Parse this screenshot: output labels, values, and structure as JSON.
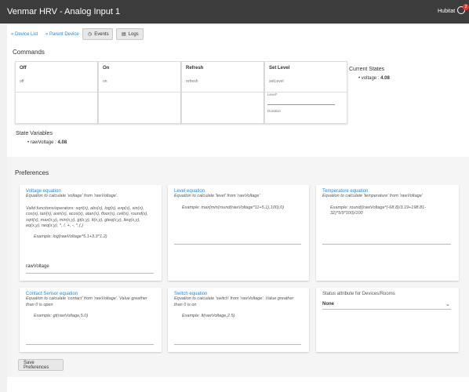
{
  "header": {
    "title": "Venmar HRV - Analog Input 1",
    "hub_name": "Hubitat",
    "notification_count": "2"
  },
  "nav": {
    "device_list": "« Device List",
    "parent_device": "« Parent Device",
    "events": "Events",
    "logs": "Logs"
  },
  "commands": {
    "heading": "Commands",
    "items": [
      {
        "name": "Off",
        "sub": "off"
      },
      {
        "name": "On",
        "sub": "on"
      },
      {
        "name": "Refresh",
        "sub": "refresh"
      },
      {
        "name": "Set Level",
        "sub": "setLevel",
        "field1": "Level*",
        "field2": "Duration"
      }
    ]
  },
  "current_states": {
    "heading": "Current States",
    "items": [
      {
        "name": "voltage",
        "value": "4.08"
      }
    ]
  },
  "state_variables": {
    "heading": "State Variables",
    "items": [
      {
        "name": "rawVoltage",
        "value": "4.08"
      }
    ]
  },
  "preferences": {
    "heading": "Preferences",
    "voltage": {
      "title": "Voltage equation",
      "desc": "Equation to calculate 'voltage' from 'rawVoltage'.",
      "functions": "Valid functions/operators: sqrt(x), abs(x), log(x), exp(x), sin(x), cos(x), tan(x), asin(x), acos(x), atan(x), floor(x), ceil(x), round(x), sqrt(x), max(x,y), min(x,y), gt(x,y), lt(x,y), gteq(x,y), lteq(x,y), eq(x,y), neq(x,y), *, /, +, -, ^,(,)",
      "example": "Example: log(rawVoltage*5.1+3.3^1.2)",
      "value": "rawVoltage"
    },
    "level": {
      "title": "Level equation",
      "desc": "Equation to calculate 'level' from 'rawVoltage'",
      "example": "Example: max(min(round(rawVoltage*11+5.1),100),0)"
    },
    "temperature": {
      "title": "Temperature equation",
      "desc": "Equation to calculate 'temperature' from 'rawVoltage'",
      "example": "Example: round((rawVoltage*(-68.8)/3.19+198.81-32)*5/9*100)/100"
    },
    "contact": {
      "title": "Contact Sensor equation",
      "desc": "Equation to calculate 'contact' from 'rawVoltage'. Value greather than 0 is open",
      "example": "Example: gt(rawVoltage,5.0)"
    },
    "switch": {
      "title": "Switch equation",
      "desc": "Equation to calculate 'switch' from 'rawVoltage'. Value greather than 0 is on",
      "example": "Example: lt(rawVoltage,2.5)"
    },
    "status": {
      "label": "Status attribute for Devices/Rooms",
      "value": "None"
    },
    "save_label": "Save Preferences"
  },
  "colors": {
    "topbar": "#3c3c3c",
    "link": "#1e88e5",
    "badge": "#e53935"
  },
  "icons": {
    "bell": "bell-icon",
    "events": "clock-icon",
    "logs": "document-icon",
    "dropdown": "chevron-down-icon"
  }
}
